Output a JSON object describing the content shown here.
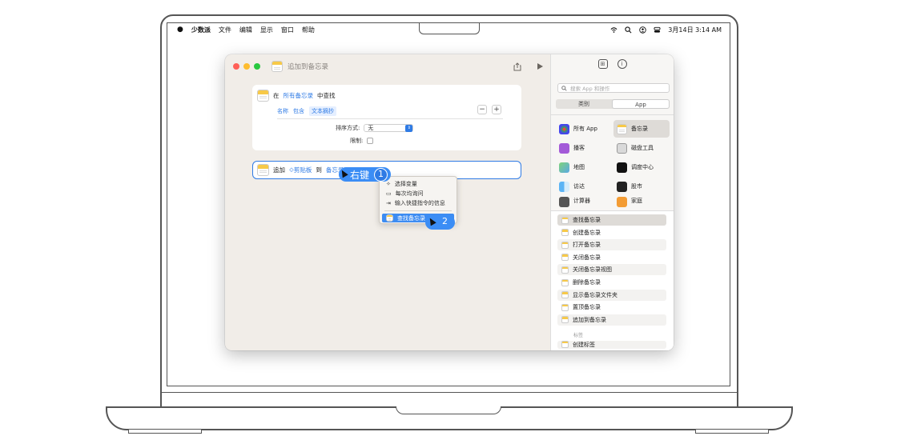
{
  "menubar": {
    "apple": "",
    "app_name": "少数派",
    "menus": [
      "文件",
      "编辑",
      "显示",
      "窗口",
      "帮助"
    ],
    "datetime": "3月14日  3:14 AM"
  },
  "window": {
    "title": "追加到备忘录"
  },
  "find_card": {
    "prefix": "在",
    "source": "所有备忘录",
    "suffix": "中查找",
    "filter_field": "名称",
    "filter_op": "包含",
    "filter_value": "文本摘抄",
    "minus": "−",
    "plus": "+",
    "sort_label": "排序方式:",
    "sort_value": "无",
    "limit_label": "限制:"
  },
  "append_card": {
    "verb": "追加",
    "variable": "剪贴板",
    "to": "到",
    "target": "备忘录"
  },
  "context_menu": {
    "items": [
      "选择变量",
      "每次均询问",
      "输入快捷指令的信息"
    ],
    "selected": "查找备忘录"
  },
  "annotations": {
    "step1_label": "右键",
    "step1_num": "1",
    "step2_num": "2"
  },
  "sidebar": {
    "search_placeholder": "搜索 App 和操作",
    "segments": [
      "类别",
      "App"
    ],
    "apps": [
      "所有 App",
      "备忘录",
      "播客",
      "磁盘工具",
      "地图",
      "调度中心",
      "访达",
      "股市",
      "计算器",
      "家庭"
    ],
    "actions": [
      "查找备忘录",
      "创建备忘录",
      "打开备忘录",
      "关闭备忘录",
      "关闭备忘录视图",
      "删除备忘录",
      "显示备忘录文件夹",
      "置顶备忘录",
      "追加到备忘录"
    ],
    "section_label": "标签",
    "section_first": "创建标签"
  },
  "colors": {
    "accent": "#2f7be5",
    "window_bg": "#f1ede8",
    "notes_yellow": "#f7c948"
  }
}
